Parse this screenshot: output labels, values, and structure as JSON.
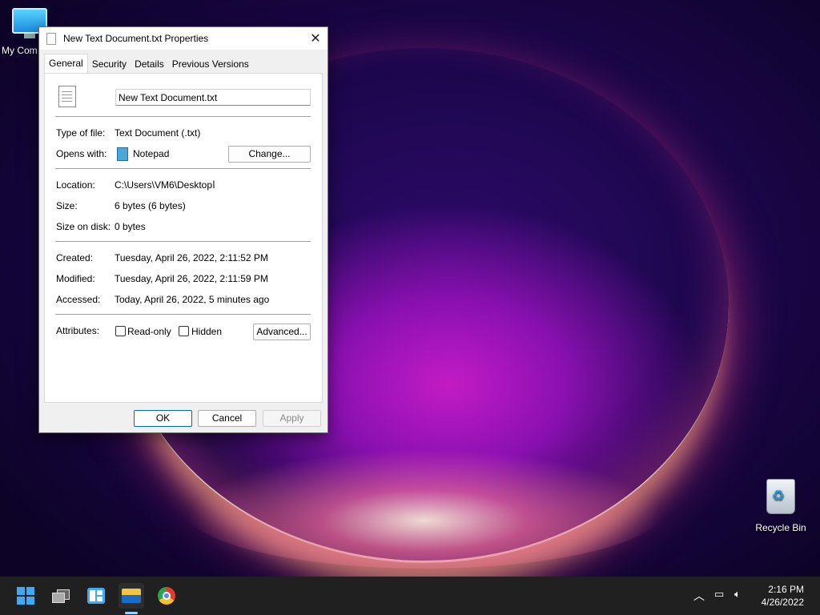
{
  "desktop": {
    "icons": [
      {
        "label": "My Com"
      },
      {
        "label": "Recycle Bin"
      }
    ]
  },
  "dialog": {
    "title": "New Text Document.txt Properties",
    "close_glyph": "✕",
    "tabs": [
      "General",
      "Security",
      "Details",
      "Previous Versions"
    ],
    "active_tab": "General",
    "file_name": "New Text Document.txt",
    "type_of_file": {
      "label": "Type of file:",
      "value": "Text Document (.txt)"
    },
    "opens_with": {
      "label": "Opens with:",
      "value": "Notepad",
      "button": "Change..."
    },
    "location": {
      "label": "Location:",
      "value": "C:\\Users\\VM6\\Desktop"
    },
    "size": {
      "label": "Size:",
      "value": "6 bytes (6 bytes)"
    },
    "size_on_disk": {
      "label": "Size on disk:",
      "value": "0 bytes"
    },
    "created": {
      "label": "Created:",
      "value": "Tuesday, April 26, 2022, 2:11:52 PM"
    },
    "modified": {
      "label": "Modified:",
      "value": "Tuesday, April 26, 2022, 2:11:59 PM"
    },
    "accessed": {
      "label": "Accessed:",
      "value": "Today, April 26, 2022, 5 minutes ago"
    },
    "attributes": {
      "label": "Attributes:",
      "read_only": {
        "label": "Read-only",
        "checked": false
      },
      "hidden": {
        "label": "Hidden",
        "checked": false
      },
      "advanced_button": "Advanced..."
    },
    "buttons": {
      "ok": "OK",
      "cancel": "Cancel",
      "apply": "Apply"
    }
  },
  "taskbar": {
    "apps": [
      "start",
      "task-view",
      "widgets",
      "file-explorer",
      "chrome"
    ],
    "tray": {
      "chevron": "^"
    },
    "clock": {
      "time": "2:16 PM",
      "date": "4/26/2022"
    }
  },
  "colors": {
    "accent": "#0067c0",
    "taskbar": "#202020"
  }
}
